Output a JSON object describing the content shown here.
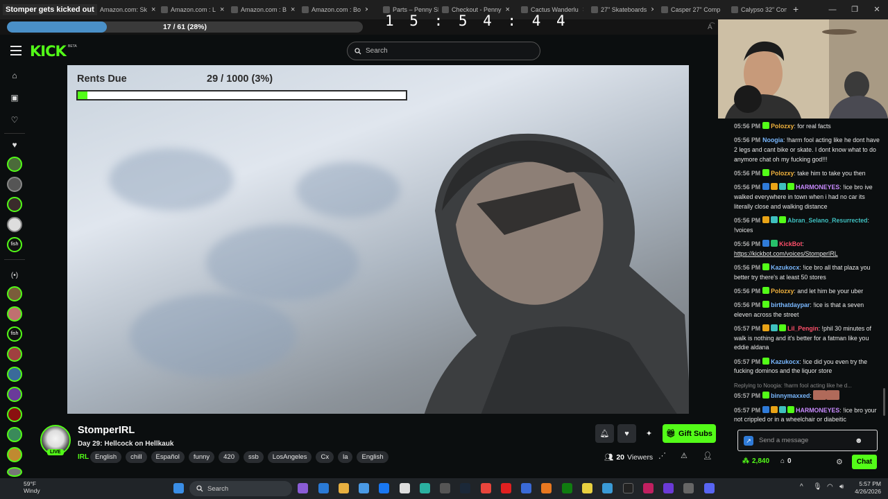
{
  "browser": {
    "tabs": [
      {
        "label": "Stomper gets kicked out",
        "active": true
      },
      {
        "label": "Amazon.com: Sk"
      },
      {
        "label": "Amazon.com : L"
      },
      {
        "label": "Amazon.com : B"
      },
      {
        "label": "Amazon.com : Bo"
      },
      {
        "label": "Parts – Penny Sk"
      },
      {
        "label": "Checkout - Penny"
      },
      {
        "label": "Cactus Wanderlu"
      },
      {
        "label": "27\" Skateboards"
      },
      {
        "label": "Casper 27\" Comp"
      },
      {
        "label": "Calypso 32\" Con"
      }
    ]
  },
  "overlay": {
    "progress_text": "17 / 61 (28%)",
    "progress_fraction": 0.28,
    "timer": "1 5 : 5 4 : 4 4"
  },
  "kick": {
    "logo": "KICK",
    "logo_tag": "BETA",
    "search_placeholder": "Search"
  },
  "video": {
    "rents_label": "Rents Due",
    "rents_count": "29 / 1000 (3%)",
    "rents_fraction": 0.03
  },
  "streamer": {
    "name": "StomperIRL",
    "live": "LIVE",
    "title": "Day 29: Hellcock on Hellkauk",
    "category": "IRL",
    "tags": [
      "English",
      "chill",
      "Español",
      "funny",
      "420",
      "ssb",
      "LosAngeles",
      "Cx",
      "la",
      "English"
    ],
    "viewers_count": "20",
    "viewers_label": "Viewers",
    "gift_label": "Gift Subs"
  },
  "chat": {
    "messages": [
      {
        "time": "05:56 PM",
        "user": "Polozxy",
        "color": "#f2b33d",
        "text": "for real facts",
        "badges": [
          "#53fc18"
        ]
      },
      {
        "time": "05:56 PM",
        "user": "Noogia",
        "color": "#79b8ff",
        "text": "!harm fool acting like he dont have 2 legs and cant bike or skate. I dont know what to do anymore chat oh my fucking god!!!",
        "badges": []
      },
      {
        "time": "05:56 PM",
        "user": "Polozxy",
        "color": "#f2b33d",
        "text": "take him to take you then",
        "badges": [
          "#53fc18"
        ]
      },
      {
        "time": "05:56 PM",
        "user": "HARMONEYES",
        "color": "#c98bff",
        "text": "!ice bro ive walked everywhere in town when i had no car its literally close and walking distance",
        "badges": [
          "#2f7bd8",
          "#e8a317",
          "#3fbfbf",
          "#53fc18"
        ]
      },
      {
        "time": "05:56 PM",
        "user": "Abran_Selano_Resurrected",
        "color": "#3fbfbf",
        "text": "!voices",
        "badges": [
          "#e8a317",
          "#3fbfbf",
          "#53fc18"
        ]
      },
      {
        "time": "05:56 PM",
        "user": "KickBot",
        "color": "#ff4f6a",
        "text": "https://kickbot.com/voices/StomperIRL",
        "link": true,
        "badges": [
          "#2f7bd8",
          "#27c06a"
        ]
      },
      {
        "time": "05:56 PM",
        "user": "Kazukocx",
        "color": "#79b8ff",
        "text": "!ice bro all that plaza you better try there's at least 50 stores",
        "badges": [
          "#53fc18"
        ]
      },
      {
        "time": "05:56 PM",
        "user": "Polozxy",
        "color": "#f2b33d",
        "text": "and let him be your uber",
        "badges": [
          "#53fc18"
        ]
      },
      {
        "time": "05:56 PM",
        "user": "birthatdaypar",
        "color": "#79b8ff",
        "text": "!ice is that a seven eleven across the street",
        "badges": [
          "#53fc18"
        ]
      },
      {
        "time": "05:57 PM",
        "user": "Lil_Pengin",
        "color": "#ff4f6a",
        "text": "!phil 30 minutes of walk is nothing and it's better for a fatman like you eddie aldana",
        "badges": [
          "#e8a317",
          "#3fbfbf",
          "#53fc18"
        ]
      },
      {
        "time": "05:57 PM",
        "user": "Kazukocx",
        "color": "#79b8ff",
        "text": "!ice did you even try the fucking dominos and the liquor store",
        "badges": [
          "#53fc18"
        ]
      },
      {
        "time": "05:57 PM",
        "user": "binnymaxxed",
        "color": "#79b8ff",
        "text": "",
        "emote": true,
        "reply": "Replying to Noogia: !harm fool acting like he d...",
        "badges": [
          "#53fc18"
        ]
      },
      {
        "time": "05:57 PM",
        "user": "HARMONEYES",
        "color": "#c98bff",
        "text": "!ice bro your not crippled or in a wheelchair or diabeitic",
        "badges": [
          "#2f7bd8",
          "#e8a317",
          "#3fbfbf",
          "#53fc18"
        ]
      }
    ],
    "input_placeholder": "Send a message",
    "points": "2,840",
    "subs": "0",
    "chat_button": "Chat"
  },
  "taskbar": {
    "weather_temp": "59°F",
    "weather_desc": "Windy",
    "search_placeholder": "Search",
    "time": "5:57 PM",
    "date": "4/26/2026"
  }
}
